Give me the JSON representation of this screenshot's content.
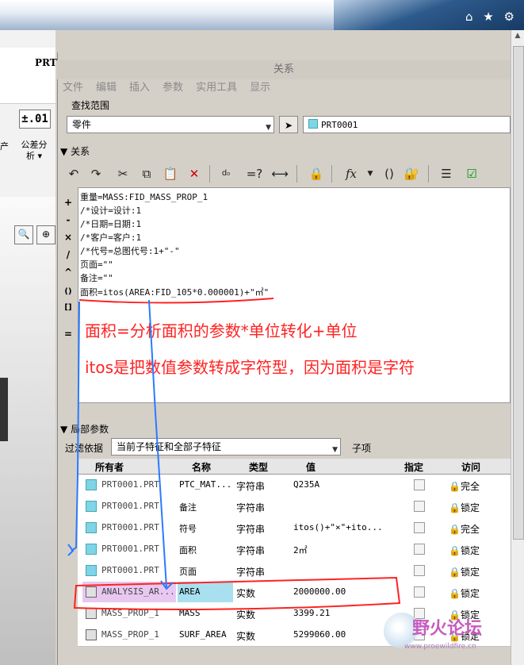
{
  "browser": {
    "toolbar_icons": "⌂ ★ ⚙"
  },
  "background_app": {
    "part_label": "PRT",
    "tolerance_symbol": "±.01",
    "tolerance_label": "公差分\n析 ▾",
    "fragment": "产"
  },
  "dialog": {
    "title": "关系",
    "menu": [
      "文件",
      "编辑",
      "插入",
      "参数",
      "实用工具",
      "显示"
    ],
    "lookup": {
      "label": "查找范围",
      "scope_value": "零件",
      "model_value": "PRT0001"
    },
    "relations": {
      "label": "关系",
      "lines": [
        "重量=MASS:FID_MASS_PROP_1",
        "/*设计=设计:1",
        "/*日期=日期:1",
        "/*客户=客户:1",
        "/*代号=总图代号:1+\"-\"",
        "页面=\"\"",
        "备注=\"\"",
        "面积=itos(AREA:FID_105*0.000001)+\"㎡\""
      ],
      "operators": [
        "+",
        "-",
        "×",
        "/",
        "^",
        "()",
        "[]",
        "="
      ]
    },
    "local_params": {
      "label": "局部参数",
      "filter_label": "过滤依据",
      "filter_value": "当前子特征和全部子特征",
      "child_label": "子项",
      "columns": [
        "所有者",
        "名称",
        "类型",
        "值",
        "指定",
        "访问"
      ],
      "rows": [
        {
          "owner": "PRT0001.PRT",
          "name": "PTC_MAT...",
          "type": "字符串",
          "value": "Q235A",
          "access": "完全"
        },
        {
          "owner": "PRT0001.PRT",
          "name": "备注",
          "type": "字符串",
          "value": "",
          "access": "锁定"
        },
        {
          "owner": "PRT0001.PRT",
          "name": "符号",
          "type": "字符串",
          "value": "itos()+\"×\"+ito...",
          "access": "完全"
        },
        {
          "owner": "PRT0001.PRT",
          "name": "面积",
          "type": "字符串",
          "value": "2㎡",
          "access": "锁定"
        },
        {
          "owner": "PRT0001.PRT",
          "name": "页面",
          "type": "字符串",
          "value": "",
          "access": "锁定"
        },
        {
          "owner": "ANALYSIS_AR...",
          "name": "AREA",
          "type": "实数",
          "value": "2000000.00",
          "access": "锁定"
        },
        {
          "owner": "MASS_PROP_1",
          "name": "MASS",
          "type": "实数",
          "value": "3399.21",
          "access": "锁定"
        },
        {
          "owner": "MASS_PROP_1",
          "name": "SURF_AREA",
          "type": "实数",
          "value": "5299060.00",
          "access": "锁定"
        }
      ]
    }
  },
  "annotation": {
    "line1": "面积=分析面积的参数*单位转化+单位",
    "line2": "itos是把数值参数转成字符型，因为面积是字符",
    "color": "#ff2222"
  },
  "watermark": {
    "text": "野火论坛",
    "url": "www.proewildfire.cn"
  }
}
